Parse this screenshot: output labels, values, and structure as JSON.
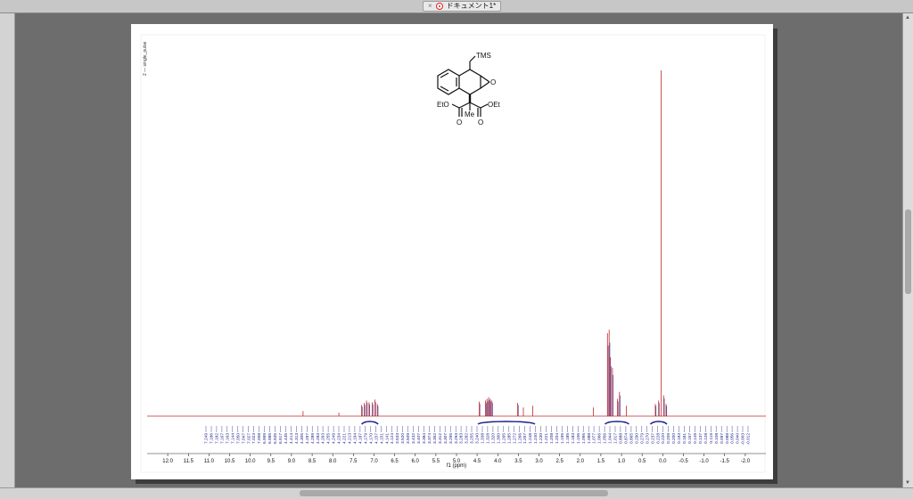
{
  "window": {
    "tab_title": "ドキュメント1*",
    "close_glyph": "×"
  },
  "icons": {
    "doc": "document-icon",
    "close": "close-icon"
  },
  "spectrum": {
    "experiment": "2 — single_pulse",
    "molecule": {
      "tms": "TMS",
      "epoxide_o": "O",
      "eto": "EtO",
      "oet": "OEt",
      "me": "Me",
      "carbonyl_o": "O"
    },
    "colors": {
      "trace": "#c0262b",
      "trace_overlay": "#1b1f8c",
      "integral": "#1b1f8c",
      "axis": "#222222"
    }
  },
  "chart_data": {
    "type": "line",
    "xlabel": "f1 (ppm)",
    "xlim": [
      12.5,
      -2.5
    ],
    "reversed": true,
    "xticks": [
      12.0,
      11.5,
      11.0,
      10.5,
      10.0,
      9.5,
      9.0,
      8.5,
      8.0,
      7.5,
      7.0,
      6.5,
      6.0,
      5.5,
      5.0,
      4.5,
      4.0,
      3.5,
      3.0,
      2.5,
      2.0,
      1.5,
      1.0,
      0.5,
      0.0,
      -0.5,
      -1.0,
      -1.5,
      -2.0
    ],
    "xtick_labels": [
      "12.0",
      "11.5",
      "11.0",
      "10.5",
      "10.0",
      "9.5",
      "9.0",
      "8.5",
      "8.0",
      "7.5",
      "7.0",
      "6.5",
      "6.0",
      "5.5",
      "5.0",
      "4.5",
      "4.0",
      "3.5",
      "3.0",
      "2.5",
      "2.0",
      "1.5",
      "1.0",
      "0.5",
      "0.0",
      "-0.5",
      "-1.0",
      "-1.5",
      "-2.0"
    ],
    "peaks": [
      {
        "ppm": 8.72,
        "h": 0.015
      },
      {
        "ppm": 7.85,
        "h": 0.01
      },
      {
        "ppm": 7.3,
        "h": 0.032
      },
      {
        "ppm": 7.24,
        "h": 0.038
      },
      {
        "ppm": 7.18,
        "h": 0.045
      },
      {
        "ppm": 7.12,
        "h": 0.04
      },
      {
        "ppm": 7.04,
        "h": 0.04
      },
      {
        "ppm": 6.98,
        "h": 0.048
      },
      {
        "ppm": 6.92,
        "h": 0.035
      },
      {
        "ppm": 4.45,
        "h": 0.042
      },
      {
        "ppm": 4.3,
        "h": 0.045
      },
      {
        "ppm": 4.26,
        "h": 0.05
      },
      {
        "ppm": 4.22,
        "h": 0.055
      },
      {
        "ppm": 4.18,
        "h": 0.05
      },
      {
        "ppm": 4.14,
        "h": 0.045
      },
      {
        "ppm": 3.52,
        "h": 0.038
      },
      {
        "ppm": 3.38,
        "h": 0.025
      },
      {
        "ppm": 3.15,
        "h": 0.03
      },
      {
        "ppm": 1.68,
        "h": 0.025
      },
      {
        "ppm": 1.34,
        "h": 0.24
      },
      {
        "ppm": 1.3,
        "h": 0.25
      },
      {
        "ppm": 1.27,
        "h": 0.17
      },
      {
        "ppm": 1.22,
        "h": 0.14
      },
      {
        "ppm": 1.1,
        "h": 0.05
      },
      {
        "ppm": 1.05,
        "h": 0.07
      },
      {
        "ppm": 0.88,
        "h": 0.03
      },
      {
        "ppm": 0.18,
        "h": 0.035
      },
      {
        "ppm": 0.1,
        "h": 0.045
      },
      {
        "ppm": 0.04,
        "h": 1.0
      },
      {
        "ppm": -0.02,
        "h": 0.06
      },
      {
        "ppm": -0.08,
        "h": 0.035
      }
    ],
    "peak_labels": [
      "7.249",
      "7.186",
      "7.182",
      "7.167",
      "7.163",
      "7.144",
      "7.050",
      "7.047",
      "7.027",
      "7.023",
      "7.008",
      "6.999",
      "6.985",
      "6.935",
      "6.917",
      "4.435",
      "4.414",
      "4.313",
      "4.305",
      "4.297",
      "4.289",
      "4.283",
      "4.263",
      "4.255",
      "4.249",
      "4.234",
      "4.221",
      "4.213",
      "4.194",
      "4.187",
      "4.179",
      "4.170",
      "4.157",
      "4.151",
      "4.141",
      "4.124",
      "3.533",
      "3.520",
      "3.509",
      "3.432",
      "3.407",
      "3.384",
      "3.374",
      "3.352",
      "3.312",
      "3.307",
      "3.295",
      "3.293",
      "3.283",
      "3.282",
      "3.255",
      "3.240",
      "1.338",
      "1.328",
      "1.320",
      "1.300",
      "1.295",
      "1.285",
      "1.272",
      "1.266",
      "1.257",
      "1.248",
      "1.240",
      "1.230",
      "1.221",
      "1.208",
      "1.204",
      "1.195",
      "1.185",
      "1.183",
      "1.106",
      "1.095",
      "1.088",
      "1.077",
      "1.066",
      "1.056",
      "1.044",
      "1.017",
      "0.888",
      "0.874",
      "0.865",
      "0.290",
      "0.279",
      "0.270",
      "0.237",
      "0.228",
      "0.220",
      "0.209",
      "0.200",
      "0.193",
      "0.181",
      "0.157",
      "0.149",
      "0.137",
      "0.128",
      "0.119",
      "0.108",
      "0.097",
      "0.088",
      "0.056",
      "0.040",
      "-0.003",
      "-0.012"
    ]
  }
}
